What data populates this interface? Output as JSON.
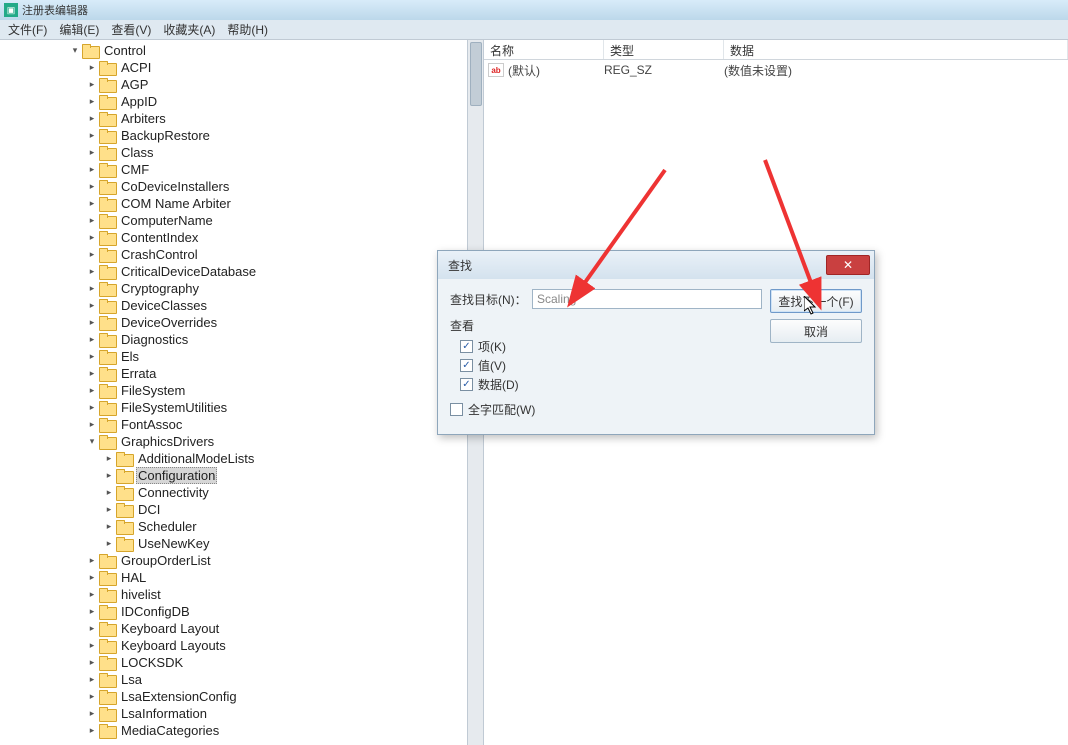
{
  "window": {
    "title": "注册表编辑器"
  },
  "menu": [
    "文件(F)",
    "编辑(E)",
    "查看(V)",
    "收藏夹(A)",
    "帮助(H)"
  ],
  "tree": {
    "root": "Control",
    "children": [
      "ACPI",
      "AGP",
      "AppID",
      "Arbiters",
      "BackupRestore",
      "Class",
      "CMF",
      "CoDeviceInstallers",
      "COM Name Arbiter",
      "ComputerName",
      "ContentIndex",
      "CrashControl",
      "CriticalDeviceDatabase",
      "Cryptography",
      "DeviceClasses",
      "DeviceOverrides",
      "Diagnostics",
      "Els",
      "Errata",
      "FileSystem",
      "FileSystemUtilities",
      "FontAssoc"
    ],
    "graphics": {
      "name": "GraphicsDrivers",
      "children": [
        "AdditionalModeLists",
        "Configuration",
        "Connectivity",
        "DCI",
        "Scheduler",
        "UseNewKey"
      ],
      "selected": "Configuration"
    },
    "after": [
      "GroupOrderList",
      "HAL",
      "hivelist",
      "IDConfigDB",
      "Keyboard Layout",
      "Keyboard Layouts",
      "LOCKSDK",
      "Lsa",
      "LsaExtensionConfig",
      "LsaInformation",
      "MediaCategories"
    ]
  },
  "list": {
    "columns": {
      "name": "名称",
      "type": "类型",
      "data": "数据"
    },
    "rows": [
      {
        "name": "(默认)",
        "type": "REG_SZ",
        "data": "(数值未设置)"
      }
    ]
  },
  "dialog": {
    "title": "查找",
    "target_label": "查找目标(N)：",
    "target_value": "Scaling",
    "look_label": "查看",
    "chk_keys": "项(K)",
    "chk_values": "值(V)",
    "chk_data": "数据(D)",
    "chk_whole": "全字匹配(W)",
    "btn_find": "查找下一个(F)",
    "btn_cancel": "取消"
  }
}
